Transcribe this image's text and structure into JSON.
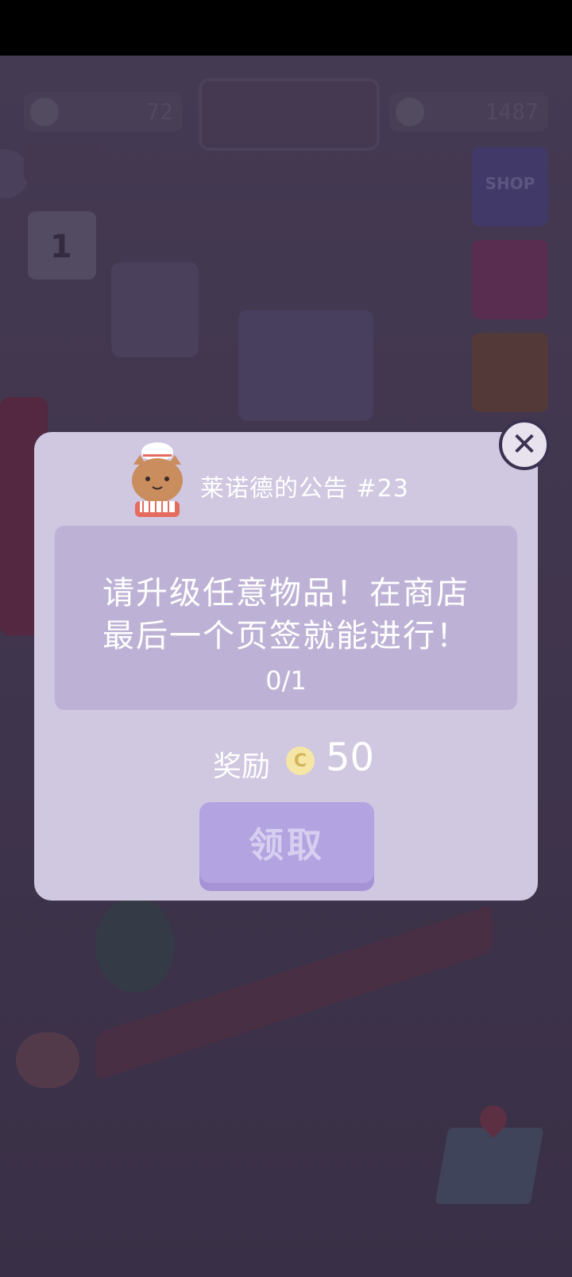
{
  "hud": {
    "left_value": "72",
    "right_value": "1487"
  },
  "side_buttons": {
    "shop_label": "SHOP"
  },
  "calendar": {
    "day": "1"
  },
  "dialog": {
    "title": "莱诺德的公告 #23",
    "task_line1": "请升级任意物品！在商店",
    "task_line2": "最后一个页签就能进行！",
    "progress": "0/1",
    "reward_label": "奖励",
    "coin_symbol": "C",
    "reward_value": "50",
    "claim_button": "领取",
    "close_symbol": "✕"
  }
}
